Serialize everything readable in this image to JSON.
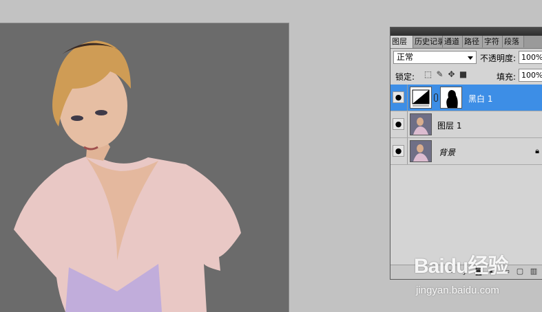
{
  "tabs": [
    {
      "label": "图层",
      "active": true
    },
    {
      "label": "历史记录",
      "active": false
    },
    {
      "label": "通道",
      "active": false
    },
    {
      "label": "路径",
      "active": false
    },
    {
      "label": "字符",
      "active": false
    },
    {
      "label": "段落",
      "active": false
    }
  ],
  "blend_mode": "正常",
  "opacity_label": "不透明度:",
  "opacity_value": "100%",
  "lock_label": "锁定:",
  "fill_label": "填充:",
  "fill_value": "100%",
  "layers": [
    {
      "name": "黑白 1",
      "selected": true,
      "type": "adjustment"
    },
    {
      "name": "图层 1",
      "selected": false,
      "type": "pixel"
    },
    {
      "name": "背景",
      "selected": false,
      "type": "background",
      "locked": true
    }
  ],
  "watermark": {
    "logo": "Baidu经验",
    "url": "jingyan.baidu.com"
  },
  "colors": {
    "selected_layer": "#3d8ee6",
    "workspace": "#c2c2c2",
    "canvas_bg": "#6e6e6e",
    "panel_bg": "#d4d4d4"
  }
}
